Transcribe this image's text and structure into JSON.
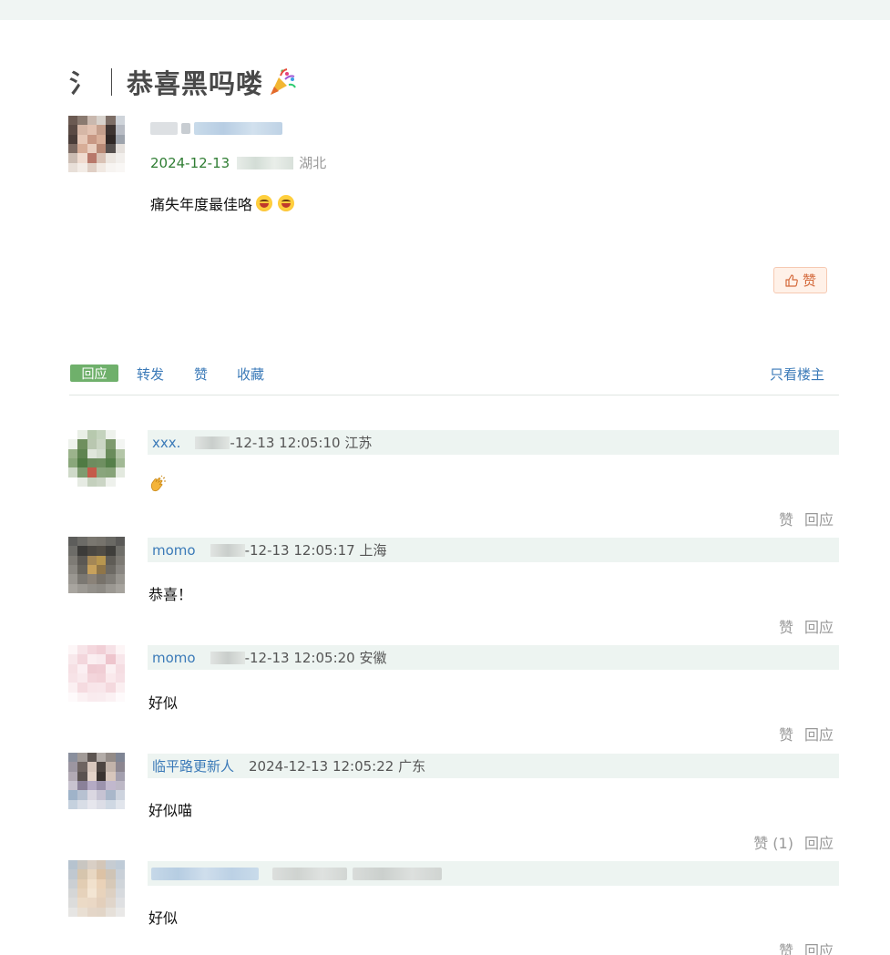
{
  "title": {
    "leading_glyph": "氵",
    "text": "恭喜黑吗喽",
    "icon": "party-popper-icon"
  },
  "post": {
    "date": "2024-12-13",
    "location": "湖北",
    "content": "痛失年度最佳咯",
    "emoji": [
      "laughing-emoji",
      "laughing-emoji"
    ],
    "like_label": "赞"
  },
  "actions": {
    "reply": "回应",
    "share": "转发",
    "like": "赞",
    "collect": "收藏",
    "only_op": "只看楼主"
  },
  "comments": [
    {
      "name": "xxx.",
      "time": "-12-13 12:05:10",
      "location": "江苏",
      "content": "",
      "content_icon": "clapping-hands-icon",
      "like": "赞",
      "reply": "回应"
    },
    {
      "name": "momo",
      "time": "-12-13 12:05:17",
      "location": "上海",
      "content": "恭喜！",
      "like": "赞",
      "reply": "回应"
    },
    {
      "name": "momo",
      "time": "-12-13 12:05:20",
      "location": "安徽",
      "content": "好似",
      "like": "赞",
      "reply": "回应"
    },
    {
      "name": "临平路更新人",
      "time": "2024-12-13 12:05:22",
      "location": "广东",
      "content": "好似喵",
      "like": "赞 (1)",
      "reply": "回应"
    },
    {
      "name": "",
      "time": "",
      "location": "",
      "content": "好似",
      "like": "赞",
      "reply": "回应"
    }
  ],
  "colors": {
    "link": "#3b7ab8",
    "date_green": "#2f7d33",
    "reply_tab": "#6fb06b",
    "header_bg": "#edf4f1",
    "like_button_bg": "#fff1e8",
    "like_button_text": "#d46a3c"
  }
}
